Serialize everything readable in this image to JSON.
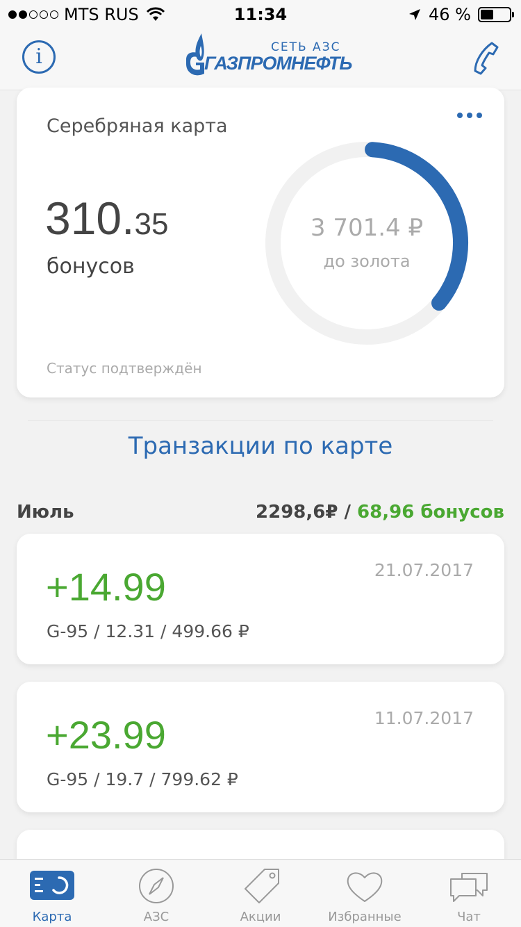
{
  "status_bar": {
    "carrier": "MTS RUS",
    "time": "11:34",
    "battery": "46 %",
    "battery_level": 0.46
  },
  "header": {
    "logo_top": "СЕТЬ АЗС",
    "logo_main": "ГАЗПРОМНЕФТЬ",
    "info_icon": "info-icon",
    "phone_icon": "phone-icon"
  },
  "loyalty_card": {
    "title": "Серебряная карта",
    "bonus_int": "310.",
    "bonus_frac": "35",
    "bonus_label": "бонусов",
    "progress_amount": "3 701.4 ₽",
    "progress_label": "до золота",
    "progress_fraction": 0.36,
    "status": "Статус подтверждён"
  },
  "section_title": "Транзакции по карте",
  "month": {
    "name": "Июль",
    "sum": "2298,6₽",
    "separator": " / ",
    "bonuses": "68,96 бонусов"
  },
  "transactions": [
    {
      "amount": "+14.99",
      "date": "21.07.2017",
      "details": "G-95 / 12.31 / 499.66 ₽"
    },
    {
      "amount": "+23.99",
      "date": "11.07.2017",
      "details": "G-95 / 19.7 / 799.62 ₽"
    }
  ],
  "tabs": [
    {
      "label": "Карта",
      "icon": "card-icon",
      "active": true
    },
    {
      "label": "АЗС",
      "icon": "compass-icon",
      "active": false
    },
    {
      "label": "Акции",
      "icon": "tag-icon",
      "active": false
    },
    {
      "label": "Избранные",
      "icon": "heart-icon",
      "active": false
    },
    {
      "label": "Чат",
      "icon": "chat-icon",
      "active": false
    }
  ],
  "colors": {
    "brand_blue": "#2c6ab2",
    "positive_green": "#4aa832",
    "ring_track": "#f1f1f1",
    "inactive_gray": "#999999"
  }
}
